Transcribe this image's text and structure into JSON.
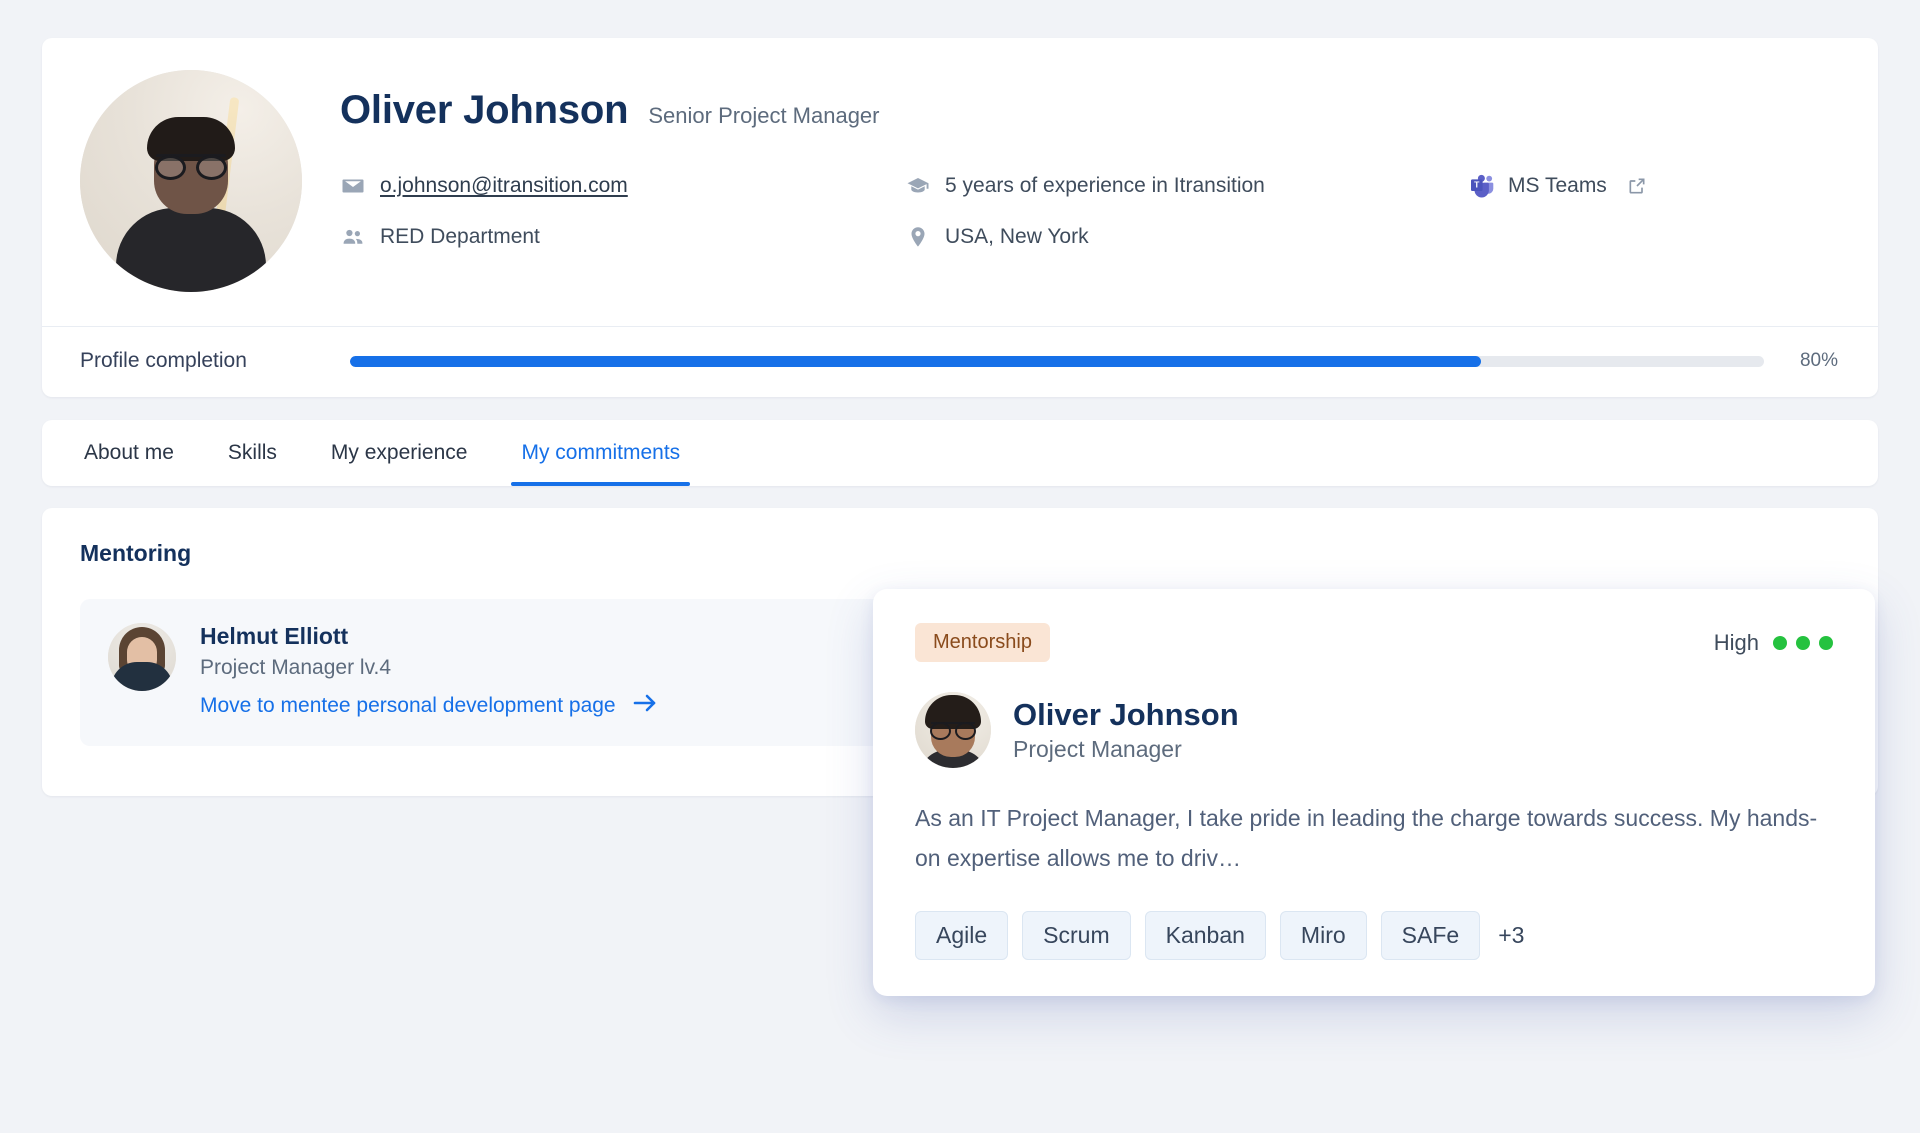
{
  "profile": {
    "name": "Oliver Johnson",
    "role": "Senior Project Manager",
    "avatar_icon": "user-photo",
    "email": "o.johnson@itransition.com",
    "email_icon": "envelope-icon",
    "department": "RED Department",
    "department_icon": "people-icon",
    "experience": "5 years of experience in Itransition",
    "experience_icon": "graduation-cap-icon",
    "location": "USA, New York",
    "location_icon": "map-pin-icon",
    "teams_label": "MS Teams",
    "teams_icon": "ms-teams-icon",
    "teams_external_icon": "external-link-icon"
  },
  "progress": {
    "label": "Profile completion",
    "value_text": "80%",
    "percent": 80,
    "fill_color": "#1670e8",
    "track_color": "#e6e9ee"
  },
  "tabs": [
    {
      "label": "About me",
      "active": false
    },
    {
      "label": "Skills",
      "active": false
    },
    {
      "label": "My experience",
      "active": false
    },
    {
      "label": "My commitments",
      "active": true
    }
  ],
  "commitments": {
    "section_title": "Mentoring",
    "mentee": {
      "avatar_icon": "mentee-photo",
      "name": "Helmut Elliott",
      "role": "Project Manager lv.4",
      "link_label": "Move to mentee personal development page",
      "link_arrow_icon": "arrow-right-icon"
    }
  },
  "hover_card": {
    "badge_label": "Mentorship",
    "badge_bg": "#fae5d5",
    "badge_color": "#8a4b1c",
    "priority_label": "High",
    "priority_dots": 3,
    "priority_dot_color": "#25c23f",
    "avatar_icon": "user-photo",
    "name": "Oliver Johnson",
    "role": "Project Manager",
    "description": "As an IT Project Manager, I take pride in leading the charge towards success. My hands-on expertise allows me to driv…",
    "tags": [
      "Agile",
      "Scrum",
      "Kanban",
      "Miro",
      "SAFe"
    ],
    "tags_more": "+3"
  }
}
